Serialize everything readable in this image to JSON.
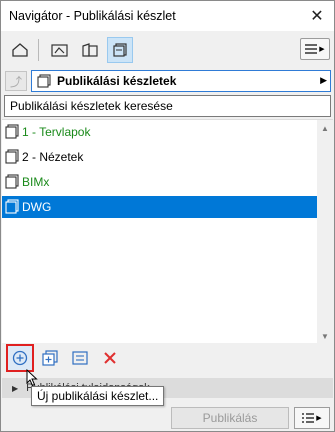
{
  "window": {
    "title": "Navigátor - Publikálási készlet"
  },
  "set_selector": {
    "value": "Publikálási készletek"
  },
  "search": {
    "placeholder": "Publikálási készletek keresése"
  },
  "tree": {
    "items": [
      {
        "label": "1 - Tervlapok",
        "color": "#1a8a1a",
        "selected": false
      },
      {
        "label": "2 - Nézetek",
        "color": "#000000",
        "selected": false
      },
      {
        "label": "BIMx",
        "color": "#1a8a1a",
        "selected": false
      },
      {
        "label": "DWG",
        "color": "#ffffff",
        "selected": true
      }
    ]
  },
  "tooltip": {
    "text": "Új publikálási készlet..."
  },
  "properties_bar": {
    "label": "Publikálási tulajdonságok"
  },
  "footer": {
    "publish_label": "Publikálás"
  },
  "colors": {
    "accent": "#0078d7",
    "highlight_border": "#e02020",
    "green_text": "#1a8a1a",
    "delete_red": "#e03030"
  }
}
